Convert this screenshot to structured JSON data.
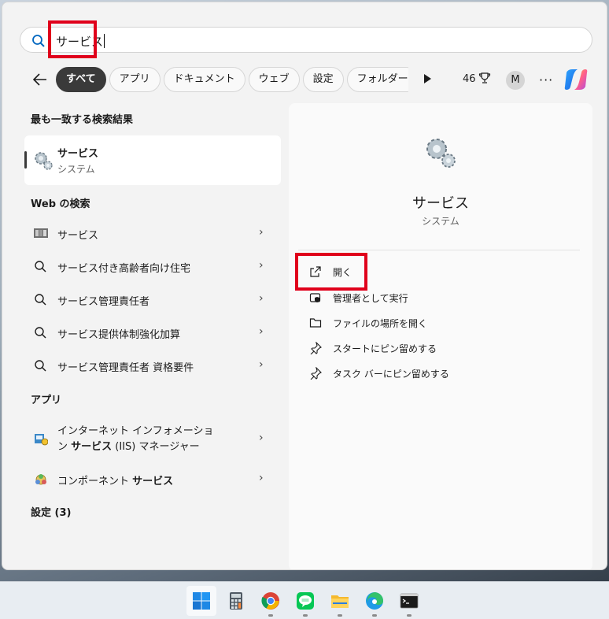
{
  "search": {
    "query": "サービス"
  },
  "filters": {
    "chips": [
      "すべて",
      "アプリ",
      "ドキュメント",
      "ウェブ",
      "設定",
      "フォルダー"
    ],
    "active_index": 0,
    "points": "46",
    "account_initial": "M",
    "more": "···"
  },
  "left": {
    "best_match_header": "最も一致する検索結果",
    "best_match": {
      "title": "サービス",
      "subtitle": "システム"
    },
    "web_header": "Web の検索",
    "web_results": [
      "サービス",
      "サービス付き高齢者向け住宅",
      "サービス管理責任者",
      "サービス提供体制強化加算",
      "サービス管理責任者 資格要件"
    ],
    "apps_header": "アプリ",
    "apps": [
      {
        "line1": "インターネット インフォメーショ",
        "line2_pre": "ン ",
        "line2_bold": "サービス",
        "line2_post": " (IIS) マネージャー"
      },
      {
        "pre": "コンポーネント ",
        "bold": "サービス"
      }
    ],
    "settings_header": "設定 (3)"
  },
  "right": {
    "title": "サービス",
    "subtitle": "システム",
    "actions": [
      "開く",
      "管理者として実行",
      "ファイルの場所を開く",
      "スタートにピン留めする",
      "タスク バーにピン留めする"
    ]
  },
  "taskbar": {
    "icons": [
      "start-icon",
      "calculator-icon",
      "chrome-icon",
      "line-icon",
      "file-explorer-icon",
      "edge-icon",
      "terminal-icon"
    ]
  },
  "colors": {
    "highlight": "#e0001b",
    "accent": "#0067c0"
  }
}
